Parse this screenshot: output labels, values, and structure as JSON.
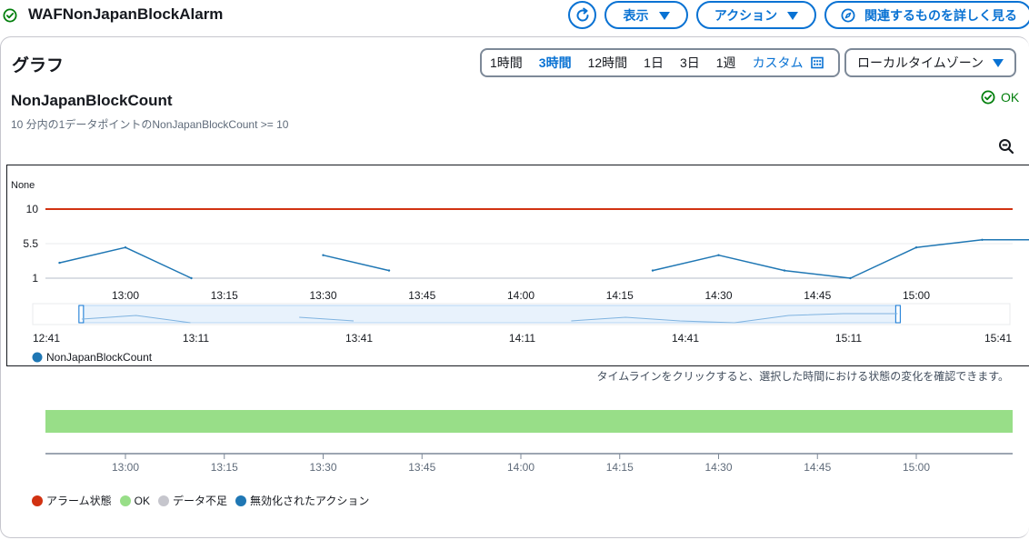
{
  "header": {
    "title": "WAFNonJapanBlockAlarm",
    "view_label": "表示",
    "actions_label": "アクション",
    "explore_label": "関連するものを詳しく見る"
  },
  "section": {
    "title": "グラフ"
  },
  "time_ranges": [
    "1時間",
    "3時間",
    "12時間",
    "1日",
    "3日",
    "1週"
  ],
  "active_range": "3時間",
  "custom_label": "カスタム",
  "timezone_label": "ローカルタイムゾーン",
  "metric": {
    "name": "NonJapanBlockCount",
    "description": "10 分内の1データポイントのNonJapanBlockCount >= 10",
    "state": "OK"
  },
  "colors": {
    "primary": "#0972d3",
    "threshold": "#d13212",
    "series": "#1f77b4",
    "ok": "#037f0c",
    "ok_band": "#98de88",
    "alarm": "#d13212",
    "insufficient": "#c6c6cd",
    "disabled": "#1f77b4"
  },
  "chart_data": {
    "type": "line",
    "unit_label": "None",
    "y_ticks": [
      1,
      5.5,
      10
    ],
    "ylim": [
      1,
      10
    ],
    "threshold": 10,
    "x_ticks": [
      "13:00",
      "13:15",
      "13:30",
      "13:45",
      "14:00",
      "14:15",
      "14:30",
      "14:45",
      "15:00"
    ],
    "series": [
      {
        "name": "NonJapanBlockCount",
        "segments": [
          [
            [
              "12:50",
              3.0
            ],
            [
              "13:00",
              5.0
            ],
            [
              "13:10",
              1.0
            ]
          ],
          [
            [
              "13:30",
              4.0
            ],
            [
              "13:40",
              2.0
            ]
          ],
          [
            [
              "14:20",
              2.0
            ],
            [
              "14:30",
              4.0
            ],
            [
              "14:40",
              2.0
            ],
            [
              "14:50",
              1.0
            ],
            [
              "15:00",
              5.0
            ],
            [
              "15:10",
              6.0
            ],
            [
              "15:20",
              6.0
            ]
          ]
        ]
      }
    ],
    "navigator_ticks": [
      "12:41",
      "13:11",
      "13:41",
      "14:11",
      "14:41",
      "15:11",
      "15:41"
    ],
    "legend": [
      "NonJapanBlockCount"
    ]
  },
  "timeline": {
    "hint": "タイムラインをクリックすると、選択した時間における状態の変化を確認できます。",
    "x_ticks": [
      "13:00",
      "13:15",
      "13:30",
      "13:45",
      "14:00",
      "14:15",
      "14:30",
      "14:45",
      "15:00"
    ],
    "legend": [
      {
        "label": "アラーム状態",
        "color": "#d13212"
      },
      {
        "label": "OK",
        "color": "#98de88"
      },
      {
        "label": "データ不足",
        "color": "#c6c6cd"
      },
      {
        "label": "無効化されたアクション",
        "color": "#1f77b4"
      }
    ]
  }
}
